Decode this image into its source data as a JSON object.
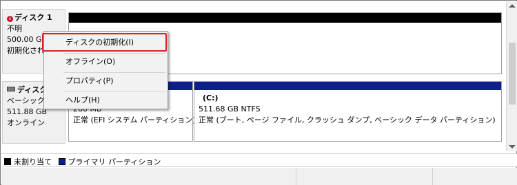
{
  "disks": {
    "disk1": {
      "title": "ディスク 1",
      "status": "不明",
      "size": "500.00 GB",
      "state": "初期化され"
    },
    "disk0": {
      "title": "ディスク",
      "type": "ベーシック",
      "size": "511.88 GB",
      "state": "オンライン"
    }
  },
  "partitions": {
    "efi": {
      "size": "260 MB",
      "status": "正常 (EFI システム パーティション)"
    },
    "c": {
      "name": "(C:)",
      "size": "511.68 GB NTFS",
      "status": "正常 (ブート, ページ ファイル, クラッシュ ダンプ, ベーシック データ パーティション)"
    }
  },
  "context_menu": {
    "items": [
      {
        "label": "ディスクの初期化(I)",
        "highlighted": true
      },
      {
        "label": "オフライン(O)"
      },
      {
        "label": "プロパティ(P)"
      },
      {
        "label": "ヘルプ(H)"
      }
    ]
  },
  "legend": {
    "items": [
      {
        "label": "未割り当て",
        "color": "#000000"
      },
      {
        "label": "プライマリ パーティション",
        "color": "#0c1f8c"
      }
    ]
  },
  "colors": {
    "primary_partition": "#0c1f8c",
    "unallocated": "#000000",
    "highlight_border": "#e02020",
    "error_icon": "#c8102e"
  }
}
